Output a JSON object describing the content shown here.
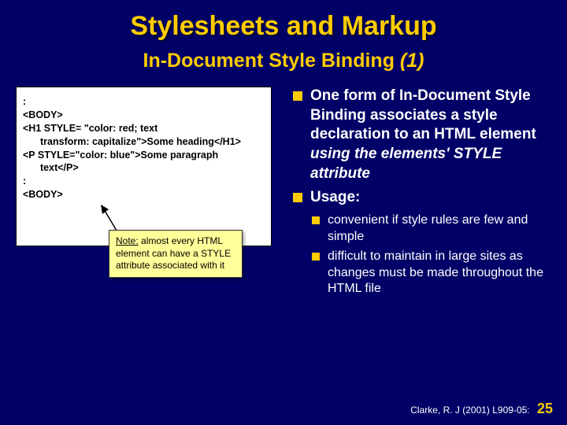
{
  "title": "Stylesheets and Markup",
  "subtitle_main": "In-Document Style Binding ",
  "subtitle_italic": "(1)",
  "code": {
    "l1": ":",
    "l2": "<BODY>",
    "l3": "<H1 STYLE= \"color: red; text",
    "l3b": "transform: capitalize\">Some heading</H1>",
    "l4": "<P STYLE=\"color: blue\">Some paragraph",
    "l4b": "text</P>",
    "l5": ":",
    "l6": "<BODY>"
  },
  "note": {
    "label": "Note:",
    "text": " almost every HTML element can have a STYLE attribute associated with it"
  },
  "bullets": {
    "b1_a": "One form of In-Document Style Binding associates a style declaration to an HTML element ",
    "b1_em": "using the elements' STYLE attribute",
    "b2": "Usage:",
    "s1": "convenient if style rules are few and simple",
    "s2": "difficult to maintain in large sites as changes must be made throughout the HTML file"
  },
  "footer": {
    "cite": "Clarke, R. J (2001) L909-05:",
    "page": "25"
  }
}
